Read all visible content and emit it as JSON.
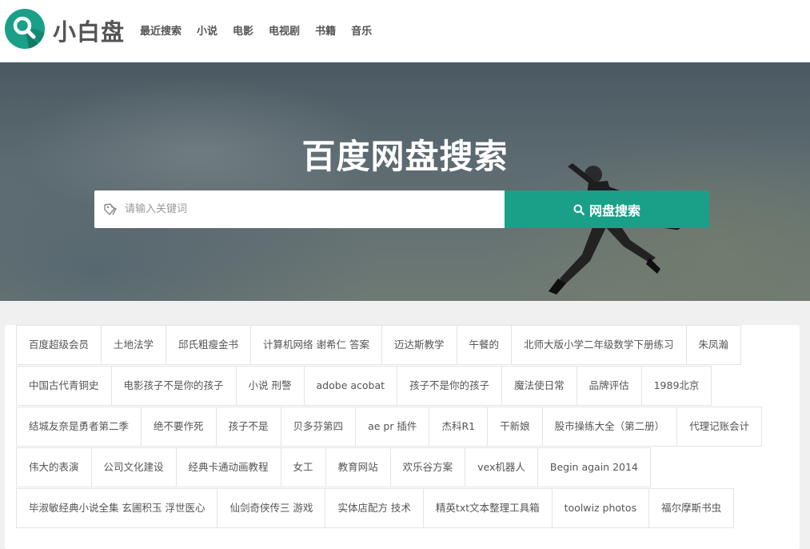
{
  "brand": {
    "name": "小白盘",
    "logo_icon": "search-icon",
    "accent": "#1aa088"
  },
  "nav": [
    {
      "label": "最近搜索"
    },
    {
      "label": "小说"
    },
    {
      "label": "电影"
    },
    {
      "label": "电视剧"
    },
    {
      "label": "书籍"
    },
    {
      "label": "音乐"
    }
  ],
  "hero": {
    "title": "百度网盘搜索",
    "search": {
      "placeholder": "请输入关键词",
      "value": "",
      "button_label": "网盘搜索"
    }
  },
  "tags": [
    [
      "百度超级会员",
      "土地法学",
      "邱氏粗瘦金书",
      "计算机网络 谢希仁 答案",
      "迈达斯教学",
      "午餐的",
      "北师大版小学二年级数学下册练习",
      "朱凤瀚"
    ],
    [
      "中国古代青铜史",
      "电影孩子不是你的孩子",
      "小说 刑警",
      "adobe acobat",
      "孩子不是你的孩子",
      "魔法使日常",
      "品牌评估",
      "1989北京"
    ],
    [
      "结城友奈是勇者第二季",
      "绝不要作死",
      "孩子不是",
      "贝多芬第四",
      "ae pr 插件",
      "杰科R1",
      "干新娘",
      "股市操练大全（第二册）",
      "代理记账会计"
    ],
    [
      "伟大的表演",
      "公司文化建设",
      "经典卡通动画教程",
      "女工",
      "教育网站",
      "欢乐谷方案",
      "vex机器人",
      "Begin again 2014"
    ],
    [
      "毕淑敏经典小说全集 玄圃积玉 浮世医心",
      "仙剑奇侠传三 游戏",
      "实体店配方 技术",
      "精英txt文本整理工具箱",
      "toolwiz photos",
      "福尔摩斯书虫"
    ]
  ]
}
